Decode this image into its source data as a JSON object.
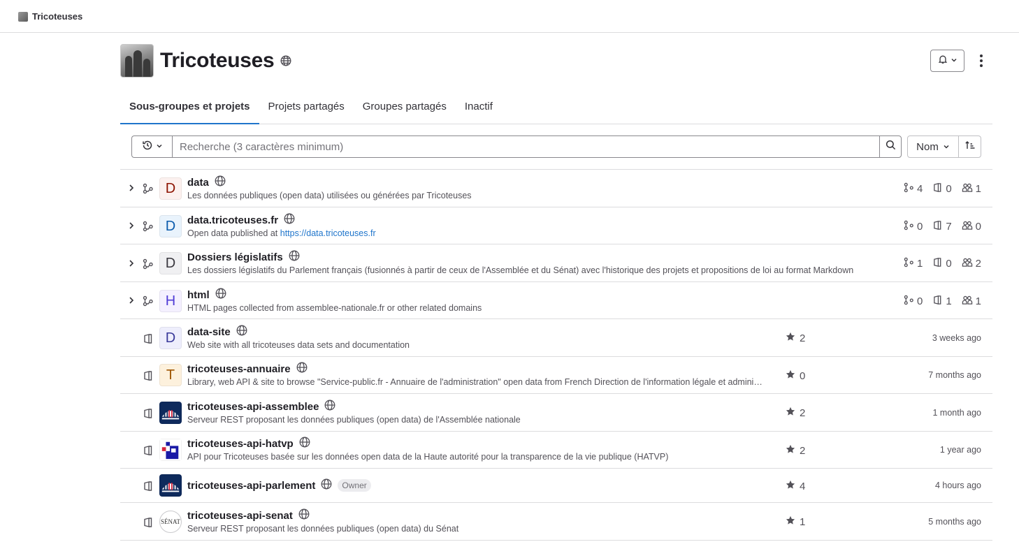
{
  "topbar": {
    "group_name": "Tricoteuses"
  },
  "header": {
    "title": "Tricoteuses",
    "visibility_icon": "globe-icon"
  },
  "tabs": [
    {
      "label": "Sous-groupes et projets",
      "active": true
    },
    {
      "label": "Projets partagés",
      "active": false
    },
    {
      "label": "Groupes partagés",
      "active": false
    },
    {
      "label": "Inactif",
      "active": false
    }
  ],
  "search": {
    "placeholder": "Recherche (3 caractères minimum)",
    "value": ""
  },
  "sort": {
    "label": "Nom"
  },
  "colors": {
    "accent": "#1f75cb",
    "border": "#dcdcde",
    "text": "#1f1e24",
    "muted": "#535158"
  },
  "subgroups": [
    {
      "name": "data",
      "letter": "D",
      "desc": "Les données publiques (open data) utilisées ou générées par Tricoteuses",
      "subgroups": "4",
      "projects": "0",
      "members": "1"
    },
    {
      "name": "data.tricoteuses.fr",
      "letter": "D",
      "desc_prefix": "Open data published at ",
      "desc_link": "https://data.tricoteuses.fr",
      "subgroups": "0",
      "projects": "7",
      "members": "0"
    },
    {
      "name": "Dossiers législatifs",
      "letter": "D",
      "desc": "Les dossiers législatifs du Parlement français (fusionnés à partir de ceux de l'Assemblée et du Sénat) avec l'historique des projets et propositions de loi au format Markdown",
      "subgroups": "1",
      "projects": "0",
      "members": "2"
    },
    {
      "name": "html",
      "letter": "H",
      "desc": "HTML pages collected from assemblee-nationale.fr or other related domains",
      "subgroups": "0",
      "projects": "1",
      "members": "1"
    }
  ],
  "projects": [
    {
      "name": "data-site",
      "letter": "D",
      "desc": "Web site with all tricoteuses data sets and documentation",
      "stars": "2",
      "updated": "3 weeks ago"
    },
    {
      "name": "tricoteuses-annuaire",
      "letter": "T",
      "desc": "Library, web API & site to browse \"Service-public.fr - Annuaire de l'administration\" open data from French Direction de l'information légale et administrative (DILA)",
      "stars": "0",
      "updated": "7 months ago"
    },
    {
      "name": "tricoteuses-api-assemblee",
      "desc": "Serveur REST proposant les données publiques (open data) de l'Assemblée nationale",
      "stars": "2",
      "updated": "1 month ago"
    },
    {
      "name": "tricoteuses-api-hatvp",
      "desc": "API pour Tricoteuses basée sur les données open data de la Haute autorité pour la transparence de la vie publique (HATVP)",
      "stars": "2",
      "updated": "1 year ago"
    },
    {
      "name": "tricoteuses-api-parlement",
      "badge": "Owner",
      "stars": "4",
      "updated": "4 hours ago"
    },
    {
      "name": "tricoteuses-api-senat",
      "avatar_text": "SÉNAT",
      "desc": "Serveur REST proposant les données publiques (open data) du Sénat",
      "stars": "1",
      "updated": "5 months ago"
    }
  ]
}
